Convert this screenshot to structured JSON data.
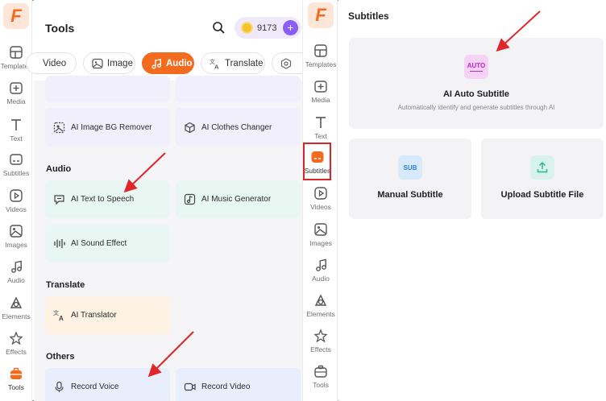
{
  "rail": {
    "logo": "F",
    "items": [
      {
        "label": "Templates",
        "icon": "templates-icon"
      },
      {
        "label": "Media",
        "icon": "media-icon"
      },
      {
        "label": "Text",
        "icon": "text-icon"
      },
      {
        "label": "Subtitles",
        "icon": "subtitles-icon"
      },
      {
        "label": "Videos",
        "icon": "videos-icon"
      },
      {
        "label": "Images",
        "icon": "images-icon"
      },
      {
        "label": "Audio",
        "icon": "audio-icon"
      },
      {
        "label": "Elements",
        "icon": "elements-icon"
      },
      {
        "label": "Effects",
        "icon": "effects-icon"
      },
      {
        "label": "Tools",
        "icon": "tools-icon",
        "active": true
      }
    ]
  },
  "tools": {
    "title": "Tools",
    "credits": "9173",
    "plus": "+",
    "tabs": [
      {
        "label": "Video",
        "icon": "video-icon"
      },
      {
        "label": "Image",
        "icon": "image-icon"
      },
      {
        "label": "Audio",
        "icon": "audio-icon",
        "active": true
      },
      {
        "label": "Translate",
        "icon": "translate-icon"
      }
    ],
    "image_cards": [
      {
        "label": "AI Image BG Remover",
        "icon": "bg-remover-icon"
      },
      {
        "label": "AI Clothes Changer",
        "icon": "clothes-icon"
      }
    ],
    "audio_section": "Audio",
    "audio_cards": [
      {
        "label": "AI Text to Speech",
        "icon": "tts-icon"
      },
      {
        "label": "AI Music Generator",
        "icon": "music-icon"
      },
      {
        "label": "AI Sound Effect",
        "icon": "sound-wave-icon"
      }
    ],
    "translate_section": "Translate",
    "translate_cards": [
      {
        "label": "AI Translator",
        "icon": "translate-icon"
      }
    ],
    "others_section": "Others",
    "others_cards": [
      {
        "label": "Record Voice",
        "icon": "mic-icon"
      },
      {
        "label": "Record Video",
        "icon": "camera-icon"
      }
    ]
  },
  "rail2": {
    "logo": "F",
    "items": [
      {
        "label": "Templates"
      },
      {
        "label": "Media"
      },
      {
        "label": "Text"
      },
      {
        "label": "Subtitles",
        "active": true
      },
      {
        "label": "Videos"
      },
      {
        "label": "Images"
      },
      {
        "label": "Audio"
      },
      {
        "label": "Elements"
      },
      {
        "label": "Effects"
      },
      {
        "label": "Tools"
      }
    ]
  },
  "subtitles": {
    "title": "Subtitles",
    "auto": {
      "icon_text": "AUTO",
      "title": "AI Auto Subtitle",
      "desc": "Automatically identify and generate subtitles through AI"
    },
    "manual": {
      "icon_text": "SUB",
      "title": "Manual Subtitle"
    },
    "upload": {
      "title": "Upload Subtitle File"
    }
  },
  "colors": {
    "accent": "#f26b1f",
    "purple": "#8b5cf6",
    "highlight": "#d7262b"
  }
}
